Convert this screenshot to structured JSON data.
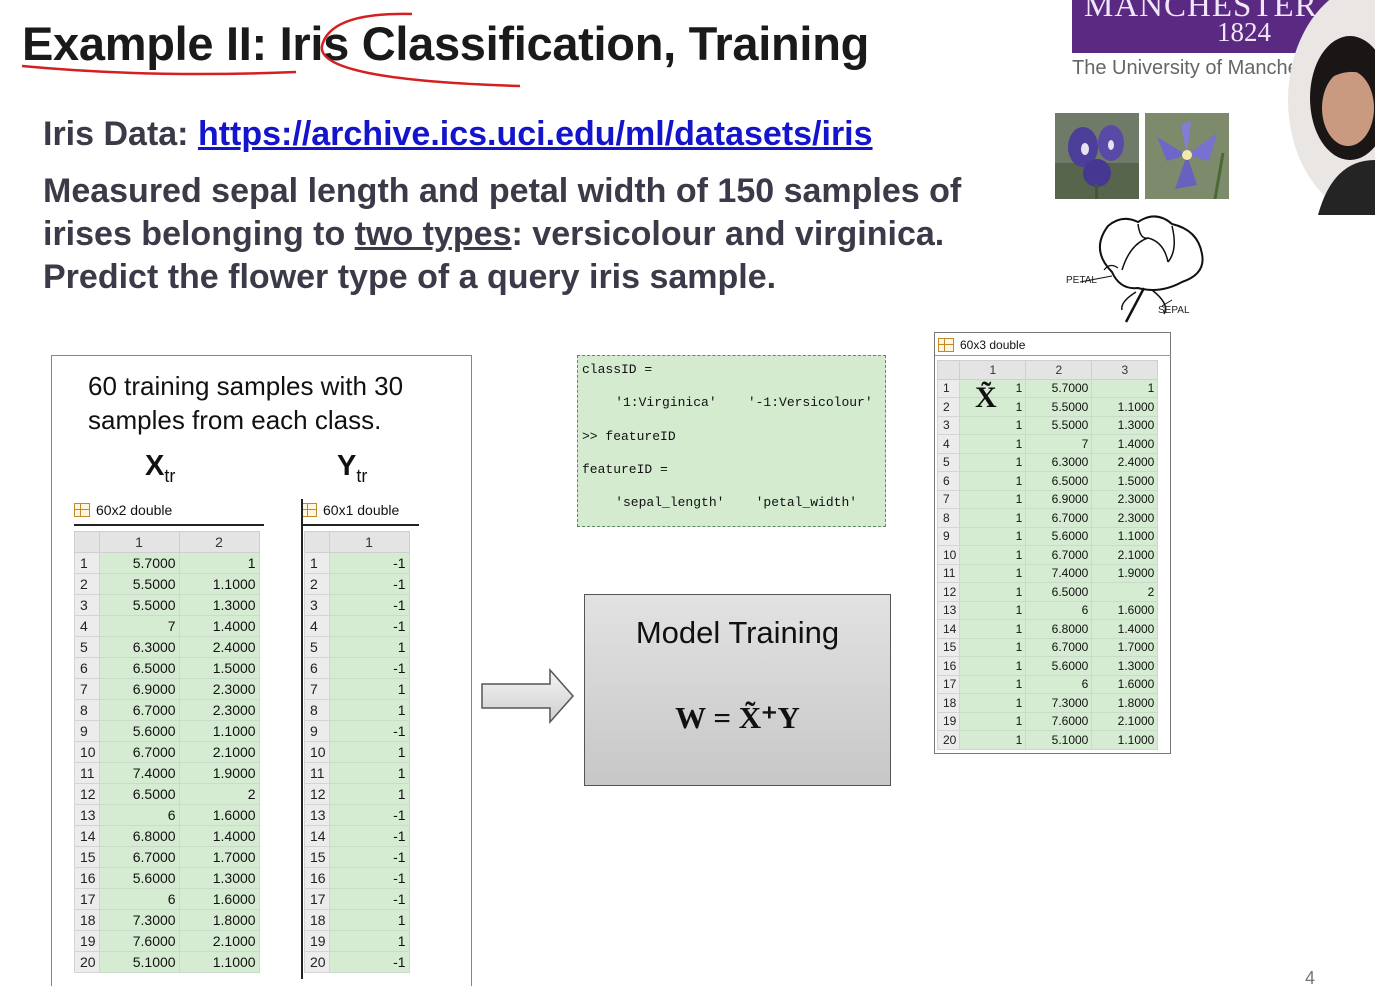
{
  "slide": {
    "title": "Example II: Iris Classification, Training",
    "logo_name": "MANCHESTER",
    "logo_year": "1824",
    "logo_sub": "The University of Manchester",
    "data_label": "Iris Data: ",
    "data_url": "https://archive.ics.uci.edu/ml/datasets/iris",
    "desc_1": "Measured sepal length and petal width of 150 samples of",
    "desc_2a": "irises belonging to ",
    "desc_2u": "two types",
    "desc_2b": ": versicolour and virginica.",
    "desc_3": "Predict the flower type of a query iris sample.",
    "petal_label": "PETAL",
    "sepal_label": "SEPAL",
    "page_number": "4"
  },
  "training": {
    "caption": "60 training samples with 30 samples from each class.",
    "x_head": "X",
    "x_sub": "tr",
    "y_head": "Y",
    "y_sub": "tr"
  },
  "console": {
    "line1": "classID =",
    "line2": "    '1:Virginica'    '-1:Versicolour'",
    "line3": ">> featureID",
    "line4": "featureID =",
    "line5": "    'sepal_length'    'petal_width'"
  },
  "model": {
    "title": "Model Training",
    "equation": "W = X̃⁺Y"
  },
  "xtilde_symbol": "X̃",
  "tables": {
    "xtr": {
      "header": "60x2 double",
      "cols": [
        "1",
        "2"
      ],
      "rows": [
        [
          "5.7000",
          "1"
        ],
        [
          "5.5000",
          "1.1000"
        ],
        [
          "5.5000",
          "1.3000"
        ],
        [
          "7",
          "1.4000"
        ],
        [
          "6.3000",
          "2.4000"
        ],
        [
          "6.5000",
          "1.5000"
        ],
        [
          "6.9000",
          "2.3000"
        ],
        [
          "6.7000",
          "2.3000"
        ],
        [
          "5.6000",
          "1.1000"
        ],
        [
          "6.7000",
          "2.1000"
        ],
        [
          "7.4000",
          "1.9000"
        ],
        [
          "6.5000",
          "2"
        ],
        [
          "6",
          "1.6000"
        ],
        [
          "6.8000",
          "1.4000"
        ],
        [
          "6.7000",
          "1.7000"
        ],
        [
          "5.6000",
          "1.3000"
        ],
        [
          "6",
          "1.6000"
        ],
        [
          "7.3000",
          "1.8000"
        ],
        [
          "7.6000",
          "2.1000"
        ],
        [
          "5.1000",
          "1.1000"
        ]
      ]
    },
    "ytr": {
      "header": "60x1 double",
      "cols": [
        "1"
      ],
      "rows": [
        [
          "-1"
        ],
        [
          "-1"
        ],
        [
          "-1"
        ],
        [
          "-1"
        ],
        [
          "1"
        ],
        [
          "-1"
        ],
        [
          "1"
        ],
        [
          "1"
        ],
        [
          "-1"
        ],
        [
          "1"
        ],
        [
          "1"
        ],
        [
          "1"
        ],
        [
          "-1"
        ],
        [
          "-1"
        ],
        [
          "-1"
        ],
        [
          "-1"
        ],
        [
          "-1"
        ],
        [
          "1"
        ],
        [
          "1"
        ],
        [
          "-1"
        ]
      ]
    },
    "xtilde": {
      "header": "60x3 double",
      "cols": [
        "1",
        "2",
        "3"
      ],
      "rows": [
        [
          "1",
          "5.7000",
          "1"
        ],
        [
          "1",
          "5.5000",
          "1.1000"
        ],
        [
          "1",
          "5.5000",
          "1.3000"
        ],
        [
          "1",
          "7",
          "1.4000"
        ],
        [
          "1",
          "6.3000",
          "2.4000"
        ],
        [
          "1",
          "6.5000",
          "1.5000"
        ],
        [
          "1",
          "6.9000",
          "2.3000"
        ],
        [
          "1",
          "6.7000",
          "2.3000"
        ],
        [
          "1",
          "5.6000",
          "1.1000"
        ],
        [
          "1",
          "6.7000",
          "2.1000"
        ],
        [
          "1",
          "7.4000",
          "1.9000"
        ],
        [
          "1",
          "6.5000",
          "2"
        ],
        [
          "1",
          "6",
          "1.6000"
        ],
        [
          "1",
          "6.8000",
          "1.4000"
        ],
        [
          "1",
          "6.7000",
          "1.7000"
        ],
        [
          "1",
          "5.6000",
          "1.3000"
        ],
        [
          "1",
          "6",
          "1.6000"
        ],
        [
          "1",
          "7.3000",
          "1.8000"
        ],
        [
          "1",
          "7.6000",
          "2.1000"
        ],
        [
          "1",
          "5.1000",
          "1.1000"
        ]
      ]
    }
  }
}
